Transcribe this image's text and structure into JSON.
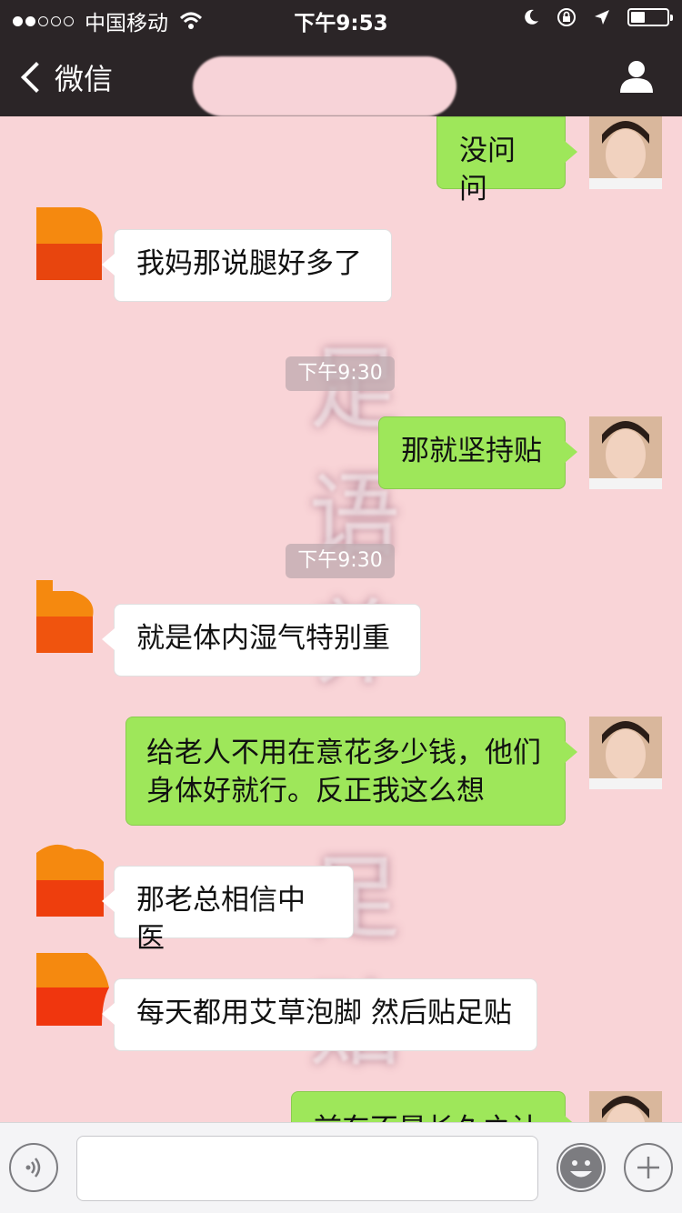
{
  "status_bar": {
    "carrier": "中国移动",
    "time": "下午9:53",
    "battery_level": 0.4
  },
  "nav": {
    "back_label": "微信"
  },
  "colors": {
    "nav_bg": "#2b2527",
    "chat_bg": "#f9d4d7",
    "my_bubble": "#9ee75a",
    "other_bubble": "#ffffff"
  },
  "watermark": "足语养生足贴",
  "messages": [
    {
      "sender": "me",
      "text": "没问问"
    },
    {
      "sender": "other",
      "text": "我妈那说腿好多了"
    },
    {
      "sender": "system",
      "text": "下午9:30"
    },
    {
      "sender": "me",
      "text": "那就坚持贴"
    },
    {
      "sender": "system",
      "text": "下午9:30"
    },
    {
      "sender": "other",
      "text": "就是体内湿气特别重"
    },
    {
      "sender": "me",
      "text": "给老人不用在意花多少钱，他们身体好就行。反正我这么想"
    },
    {
      "sender": "other",
      "text": "那老总相信中医"
    },
    {
      "sender": "other",
      "text": "每天都用艾草泡脚 然后贴足贴"
    },
    {
      "sender": "me",
      "text": "前东不是长久之计"
    }
  ],
  "icons": {
    "back": "chevron-left-icon",
    "profile": "person-icon",
    "voice": "voice-icon",
    "emoji": "emoji-icon",
    "plus": "plus-icon"
  }
}
